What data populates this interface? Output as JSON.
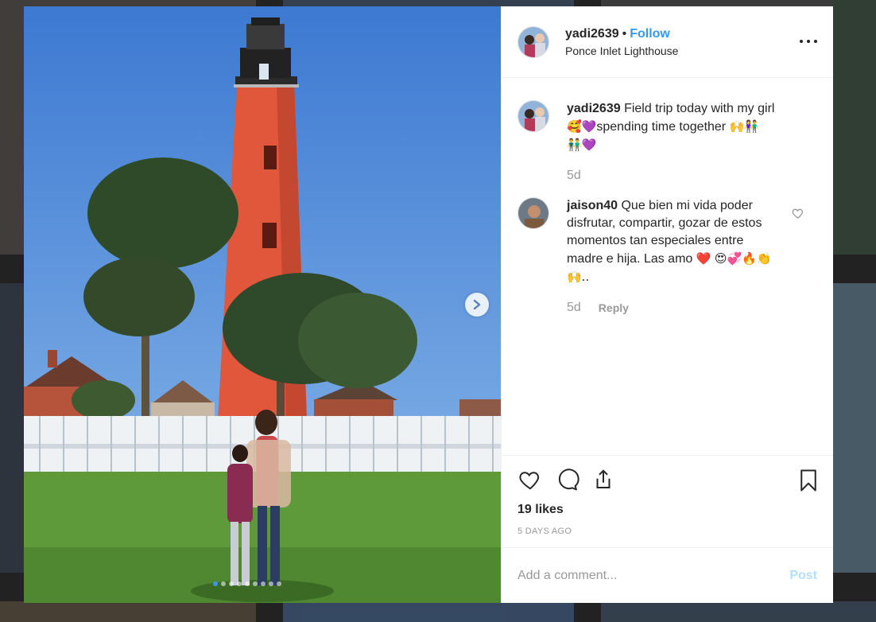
{
  "post": {
    "username": "yadi2639",
    "separator": "•",
    "follow_label": "Follow",
    "location": "Ponce Inlet Lighthouse"
  },
  "caption": {
    "username": "yadi2639",
    "text_line1": "Field trip today with my girl",
    "emoji_a": "🥰💜",
    "text_line2": "spending time together",
    "emoji_b": "🙌👫",
    "emoji_c": "👬💜",
    "time": "5d"
  },
  "comment": {
    "username": "jaison40",
    "text": "Que bien mi vida poder disfrutar, compartir, gozar de estos momentos tan especiales entre madre e hija. Las amo",
    "emoji_a": "❤️",
    "emoji_b": "😍💞🔥👏🙌..",
    "time": "5d",
    "reply_label": "Reply"
  },
  "likes": "19 likes",
  "date": "5 DAYS AGO",
  "add_comment": {
    "placeholder": "Add a comment...",
    "post_label": "Post"
  },
  "carousel": {
    "total_slides": 9,
    "active_index": 0
  },
  "colors": {
    "accent": "#3897f0",
    "post_disabled": "#b2dffc",
    "sky": "#4f8ad9",
    "lighthouse": "#e0573c",
    "grass": "#5f9a3a"
  }
}
